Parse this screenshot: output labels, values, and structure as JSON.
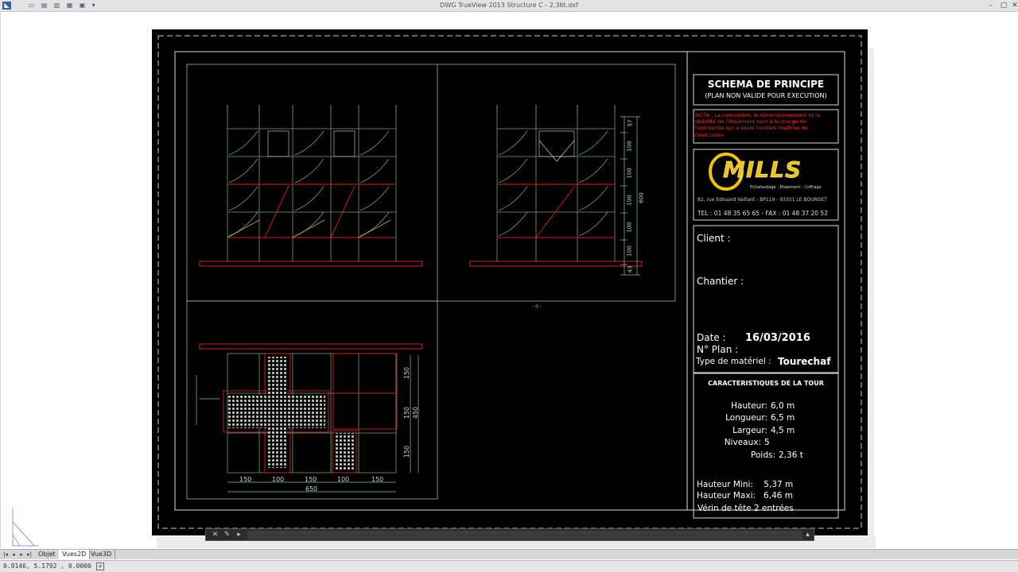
{
  "window": {
    "title": "DWG TrueView 2013    Structure C - 2,36t.dxf",
    "minimize": "–",
    "maximize": "▢",
    "close": "✕"
  },
  "quick_access": [
    "open-icon",
    "save-icon",
    "print-icon",
    "print-preview-icon",
    "page-setup-icon",
    "dropdown-icon"
  ],
  "title_block": {
    "header_title": "SCHEMA DE PRINCIPE",
    "header_sub": "(PLAN NON VALIDE POUR EXECUTION)",
    "note": [
      "NOTA : La conception, le dimensionnement et la",
      "stabilité de l'étaiement sont à la charge de",
      "l'entreprise qui a seule l'entière maîtrise de",
      "l'exécution."
    ],
    "logo": "MILLS",
    "logo_tagline": "Echafaudage - Etaiement - Coffrage",
    "address": "82, rue Edouard Vaillant - BP119 - 93351 LE BOURGET",
    "phone": "TEL : 01 48 35 65 65 -  FAX : 01 48 37 20 52",
    "client_label": "Client :",
    "chantier_label": "Chantier :",
    "date_label": "Date :",
    "date_value": "16/03/2016",
    "plan_label": "N° Plan :",
    "materiel_label": "Type de matériel :",
    "materiel_value": "Tourechaf",
    "carac_title": "CARACTERISTIQUES DE LA TOUR",
    "carac": [
      {
        "label": "Hauteur:",
        "value": "6,0 m"
      },
      {
        "label": "Longueur:",
        "value": "6,5 m"
      },
      {
        "label": "Largeur:",
        "value": "4,5 m"
      },
      {
        "label": "Niveaux:",
        "value": "5"
      },
      {
        "label": "Poids:",
        "value": "2,36 t"
      }
    ],
    "hauteur_mini": "Hauteur Mini:    5,37 m",
    "hauteur_maxi": "Hauteur Maxi:   6,46 m",
    "verin": "Vérin de tête 2 entrées"
  },
  "drawing": {
    "side_dims": [
      "57",
      "100",
      "100",
      "100",
      "100",
      "100",
      "43"
    ],
    "side_total": "600",
    "plan_dims_x": [
      "150",
      "100",
      "150",
      "100",
      "150"
    ],
    "plan_total_x": "650",
    "plan_dims_y": [
      "150",
      "150",
      "150"
    ],
    "plan_total_y": "450",
    "center_mark": "- o -"
  },
  "layout_tabs": {
    "nav": [
      "|◂",
      "◂",
      "▸",
      "▸|"
    ],
    "tabs": [
      "Objet",
      "Vues2D",
      "Vue3D"
    ],
    "active": "Vues2D"
  },
  "status": {
    "coords": "0.9146,  5.1792 , 0.0000"
  },
  "colors": {
    "sheet": "#000000",
    "frame": "#ffffff",
    "note_red": "#ff2a2a",
    "logo_yellow": "#f2c400",
    "steel_green": "#6fa07a",
    "red": "#d42020"
  }
}
